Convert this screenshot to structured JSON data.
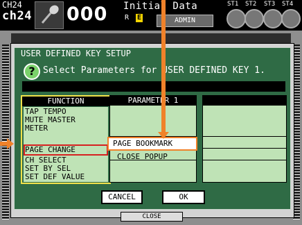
{
  "topbar": {
    "channel_id": "CH24",
    "channel_name": "ch24",
    "mic_icon": "microphone-icon",
    "scene_number": "000",
    "scene_title": "Initial Data",
    "scene_flag_r": "R",
    "scene_flag_e": "E",
    "user_level": "ADMIN",
    "stereo_labels": [
      "ST1",
      "ST2",
      "ST3",
      "ST4"
    ]
  },
  "dialog": {
    "title": "USER DEFINED KEY SETUP",
    "help_icon": "?",
    "prompt": "Select Parameters for USER DEFINED KEY 1."
  },
  "function_column": {
    "header": "FUNCTION",
    "items": [
      "TAP TEMPO",
      "MUTE MASTER",
      "METER",
      "PAGE CHANGE",
      "CH SELECT",
      "SET BY SEL",
      "SET DEF VALUE"
    ],
    "selected": "PAGE CHANGE"
  },
  "parameter_column": {
    "header": "PARAMETER 1",
    "items": [
      "PAGE BOOKMARK",
      "CLOSE POPUP"
    ],
    "selected": "PAGE BOOKMARK"
  },
  "buttons": {
    "cancel": "CANCEL",
    "ok": "OK"
  },
  "close_bar": "CLOSE",
  "colors": {
    "panel_green": "#2f6b45",
    "list_green": "#bfe3b6",
    "highlight_orange": "#f0822a",
    "selection_red": "#d62020",
    "function_border": "#f1e14a"
  }
}
